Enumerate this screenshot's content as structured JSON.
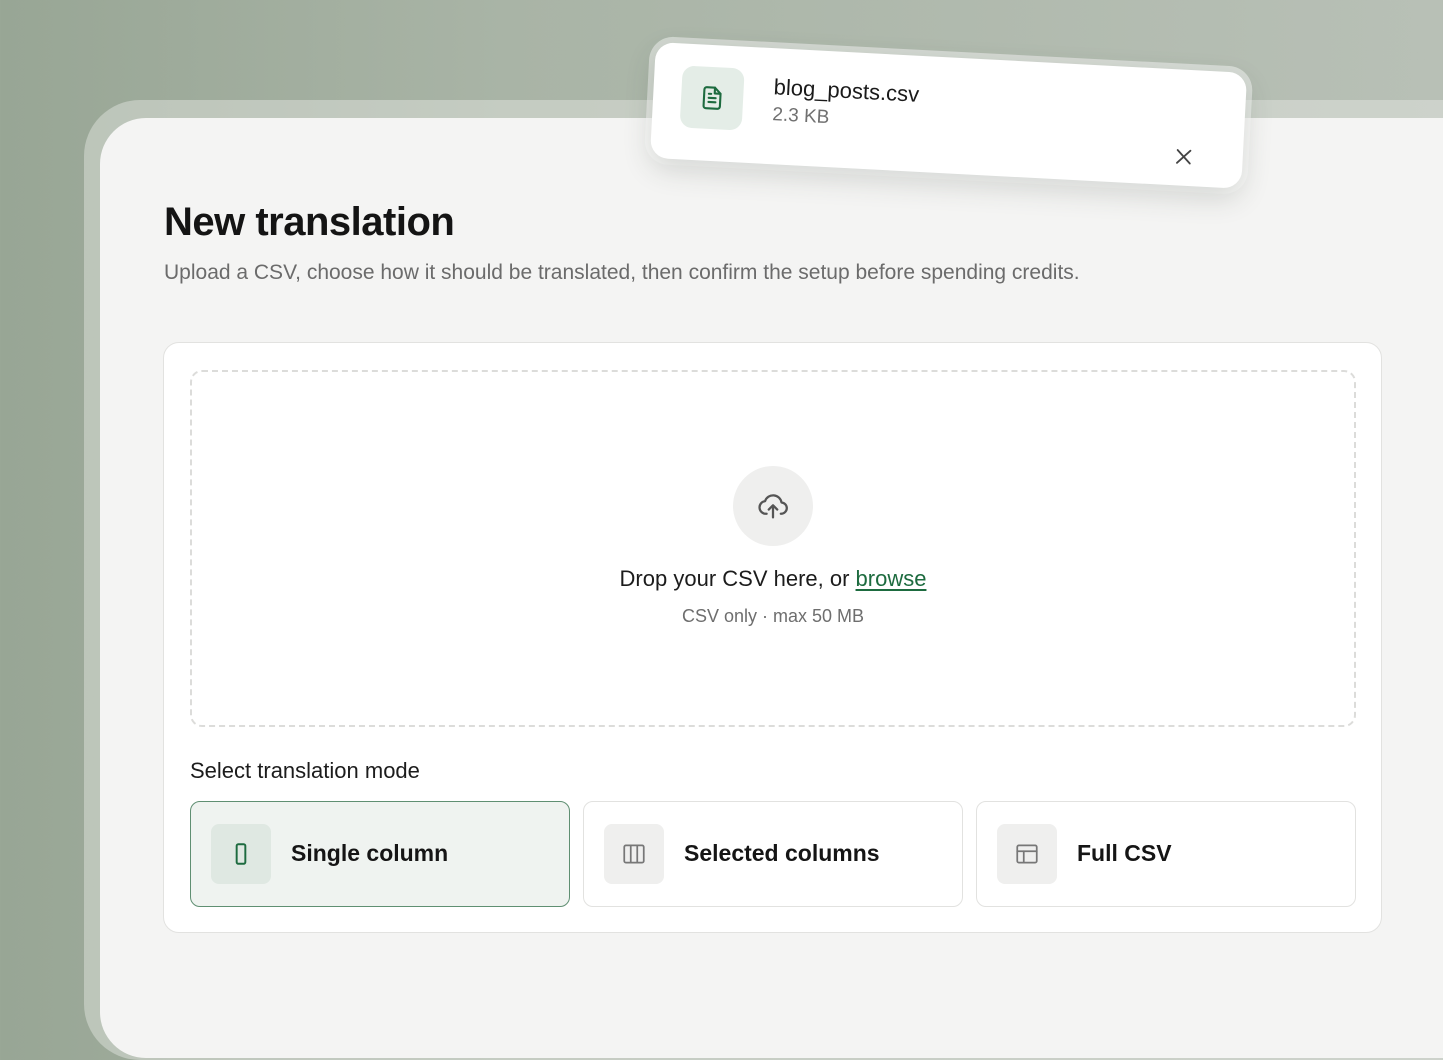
{
  "header": {
    "title": "New translation",
    "subtitle": "Upload a CSV, choose how it should be translated, then confirm the setup before spending credits."
  },
  "upload": {
    "icon": "cloud-upload-icon",
    "prompt_text": "Drop your CSV here, or ",
    "browse_label": "browse",
    "hint": "CSV only · max 50 MB"
  },
  "mode_section": {
    "label": "Select translation mode",
    "selected": "Single column",
    "modes": [
      {
        "label": "Single column",
        "icon": "single-column-icon"
      },
      {
        "label": "Selected columns",
        "icon": "columns-icon"
      },
      {
        "label": "Full CSV",
        "icon": "table-icon"
      }
    ]
  },
  "file_toast": {
    "file_name": "blog_posts.csv",
    "file_size": "2.3 KB",
    "icon": "file-text-icon"
  },
  "colors": {
    "accent": "#1d6b3f",
    "selected_border": "#5f8f72",
    "selected_bg": "#eff3f0"
  }
}
